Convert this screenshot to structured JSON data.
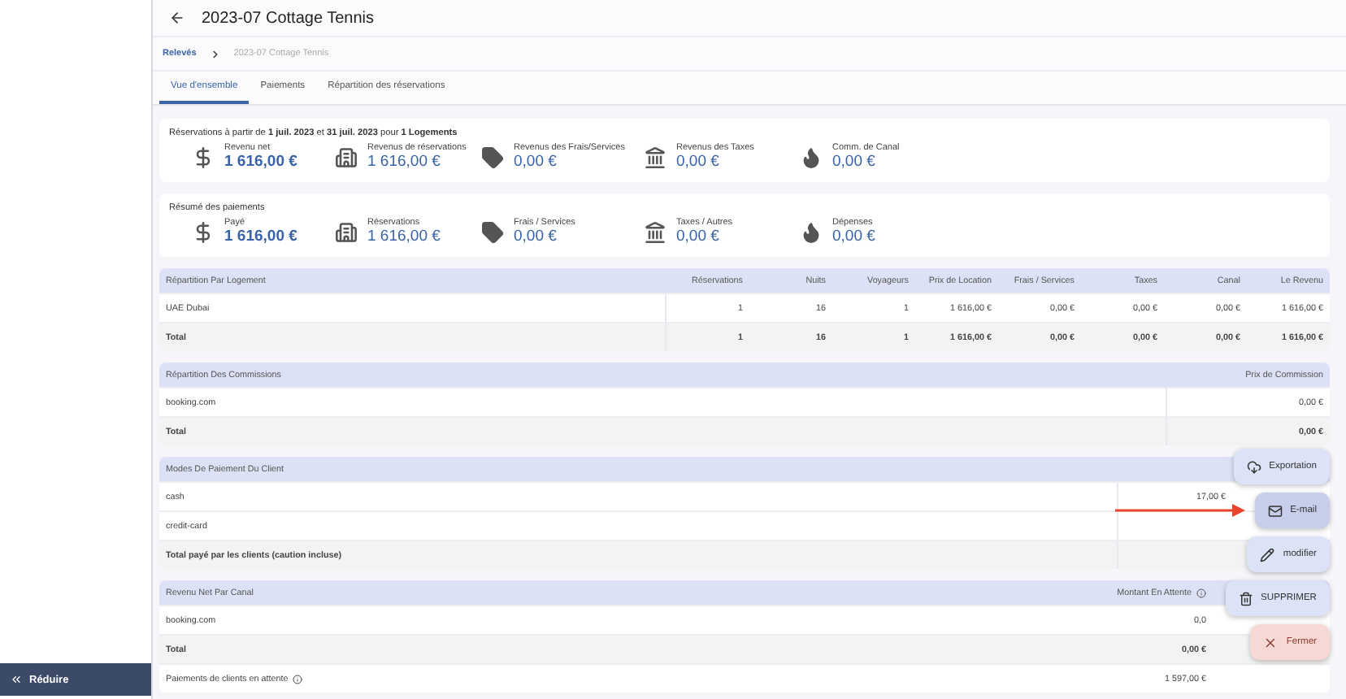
{
  "sidebar": {
    "collapse_label": "Réduire"
  },
  "header": {
    "title": "2023-07 Cottage Tennis"
  },
  "breadcrumb": [
    {
      "label": "Relevés",
      "link": true
    },
    {
      "label": "2023-07 Cottage Tennis",
      "link": false
    }
  ],
  "tabs": [
    {
      "label": "Vue d'ensemble",
      "selected": true
    },
    {
      "label": "Paiements",
      "selected": false
    },
    {
      "label": "Répartition des réservations",
      "selected": false
    }
  ],
  "summary": {
    "intro": "Réservations à partir de **1 juil. 2023** et **31 juil. 2023** pour **1 Logements**",
    "stats": [
      {
        "kind": "money",
        "label": "Revenu net",
        "value": "1 616,00 €",
        "bold": true
      },
      {
        "kind": "building",
        "label": "Revenus de réservations",
        "value": "1 616,00 €",
        "bold": false
      },
      {
        "kind": "tag",
        "label": "Revenus des Frais/Services",
        "value": "0,00 €",
        "bold": false
      },
      {
        "kind": "bank",
        "label": "Revenus des Taxes",
        "value": "0,00 €",
        "bold": false
      },
      {
        "kind": "flame",
        "label": "Comm. de Canal",
        "value": "0,00 €",
        "bold": false
      }
    ]
  },
  "payments": {
    "title": "Résumé des paiements",
    "stats": [
      {
        "kind": "money",
        "label": "Payé",
        "value": "1 616,00 €",
        "bold": true
      },
      {
        "kind": "building",
        "label": "Réservations",
        "value": "1 616,00 €",
        "bold": false
      },
      {
        "kind": "tag",
        "label": "Frais / Services",
        "value": "0,00 €",
        "bold": false
      },
      {
        "kind": "bank",
        "label": "Taxes / Autres",
        "value": "0,00 €",
        "bold": false
      },
      {
        "kind": "flame",
        "label": "Dépenses",
        "value": "0,00 €",
        "bold": false
      }
    ]
  },
  "tables": [
    {
      "kind": "breakdown",
      "columns": [
        "Répartition Par Logement",
        "Réservations",
        "Nuits",
        "Voyageurs",
        "Prix de Location",
        "Frais / Services",
        "Taxes",
        "Canal",
        "Le Revenu"
      ],
      "rows": [
        {
          "total": false,
          "cells": [
            "UAE Dubai",
            "1",
            "16",
            "1",
            "1 616,00 €",
            "0,00 €",
            "0,00 €",
            "0,00 €",
            "1 616,00 €"
          ]
        },
        {
          "total": true,
          "cells": [
            "Total",
            "1",
            "16",
            "1",
            "1 616,00 €",
            "0,00 €",
            "0,00 €",
            "0,00 €",
            "1 616,00 €"
          ]
        }
      ]
    },
    {
      "kind": "two",
      "columns": [
        "Répartition Des Commissions",
        "Prix de Commission"
      ],
      "rows": [
        {
          "total": false,
          "cells": [
            "booking.com",
            "0,00 €"
          ]
        },
        {
          "total": true,
          "cells": [
            "Total",
            "0,00 €"
          ]
        }
      ]
    },
    {
      "kind": "modes",
      "columns": [
        "Modes De Paiement Du Client"
      ],
      "rows": [
        {
          "total": false,
          "cells": [
            "cash",
            "17,00 €"
          ]
        },
        {
          "total": false,
          "cells": [
            "credit-card"
          ]
        },
        {
          "total": true,
          "cells": [
            "Total payé par les clients (caution incluse)"
          ]
        }
      ]
    },
    {
      "kind": "channel",
      "columns": [
        "Revenu Net Par Canal",
        "Montant En Attente"
      ],
      "rows": [
        {
          "total": false,
          "info": false,
          "cells": [
            "booking.com",
            "0,0"
          ]
        },
        {
          "total": true,
          "info": false,
          "cells": [
            "Total",
            "0,00 €"
          ]
        },
        {
          "total": false,
          "info": true,
          "cells": [
            "Paiements de clients en attente",
            "1 597,00 €"
          ]
        }
      ]
    }
  ],
  "actions": [
    {
      "kind": "export",
      "label": "Exportation",
      "highlighted": false
    },
    {
      "kind": "email",
      "label": "E-mail",
      "highlighted": true
    },
    {
      "kind": "edit",
      "label": "modifier",
      "highlighted": false
    },
    {
      "kind": "delete",
      "label": "SUPPRIMER",
      "highlighted": false
    },
    {
      "kind": "close",
      "label": "Fermer",
      "highlighted": false
    }
  ]
}
